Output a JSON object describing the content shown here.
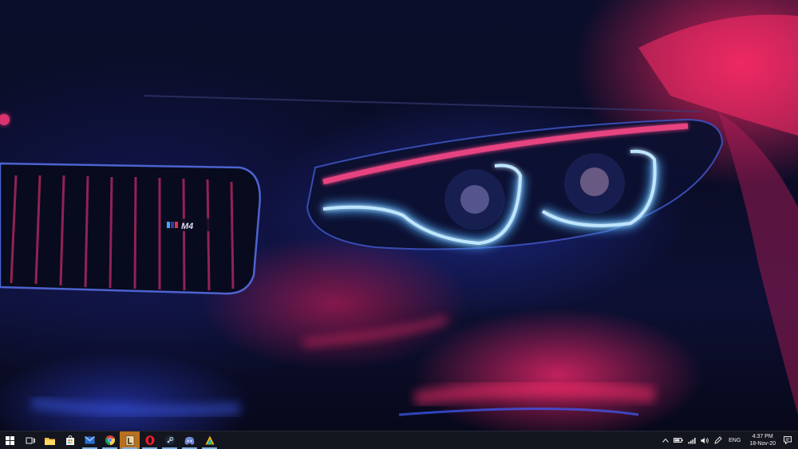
{
  "desktop": {
    "wallpaper": {
      "badge_text": "M4",
      "colors": {
        "headlight": "#7fc8ff",
        "accent_red": "#ff2a6d",
        "body": "#0d1033"
      }
    }
  },
  "taskbar": {
    "apps": [
      {
        "id": "start",
        "icon": "windows-start-icon"
      },
      {
        "id": "task-view",
        "icon": "task-view-icon"
      },
      {
        "id": "file-explorer",
        "icon": "folder-icon"
      },
      {
        "id": "store",
        "icon": "store-bag-icon"
      },
      {
        "id": "mail",
        "icon": "mail-icon"
      },
      {
        "id": "chrome",
        "icon": "chrome-icon"
      },
      {
        "id": "app-active",
        "icon": "app-l-icon"
      },
      {
        "id": "opera",
        "icon": "opera-icon"
      },
      {
        "id": "steam",
        "icon": "steam-icon"
      },
      {
        "id": "discord",
        "icon": "discord-icon"
      },
      {
        "id": "app-colorful",
        "icon": "colorful-app-icon"
      }
    ],
    "tray": {
      "language": "ENG",
      "time": "4:37 PM",
      "date": "18-Nov-20"
    }
  }
}
